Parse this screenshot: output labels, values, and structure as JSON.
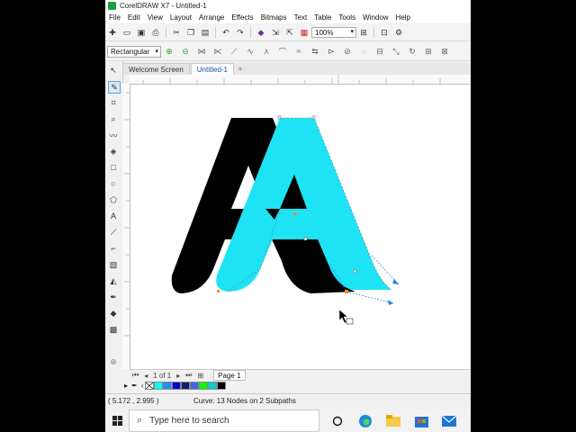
{
  "app": {
    "title": "CorelDRAW X7 - Untitled-1"
  },
  "menu": [
    "File",
    "Edit",
    "View",
    "Layout",
    "Arrange",
    "Effects",
    "Bitmaps",
    "Text",
    "Table",
    "Tools",
    "Window",
    "Help"
  ],
  "toolbar": {
    "zoom": "100%"
  },
  "property_bar": {
    "shape_mode": "Rectangular"
  },
  "tabs": [
    {
      "label": "Welcome Screen"
    },
    {
      "label": "Untitled-1"
    }
  ],
  "canvas": {
    "letters": [
      "A",
      "A"
    ],
    "colors": {
      "back_letter": "#000000",
      "front_letter": "#1ee3f5",
      "nodes": "#ff8c1a",
      "handles": "#2a7fd4"
    }
  },
  "pager": {
    "counter": "1 of 1",
    "page_tab": "Page 1"
  },
  "palette": [
    "#00ffff",
    "#1e90ff",
    "#0000cd",
    "#191970",
    "#4169e1",
    "#00ff00",
    "#00ced1",
    "#000000"
  ],
  "status": {
    "coords": "( 5.172 , 2.995 )",
    "info": "Curve: 13 Nodes on 2 Subpaths"
  },
  "taskbar": {
    "search_placeholder": "Type here to search"
  }
}
